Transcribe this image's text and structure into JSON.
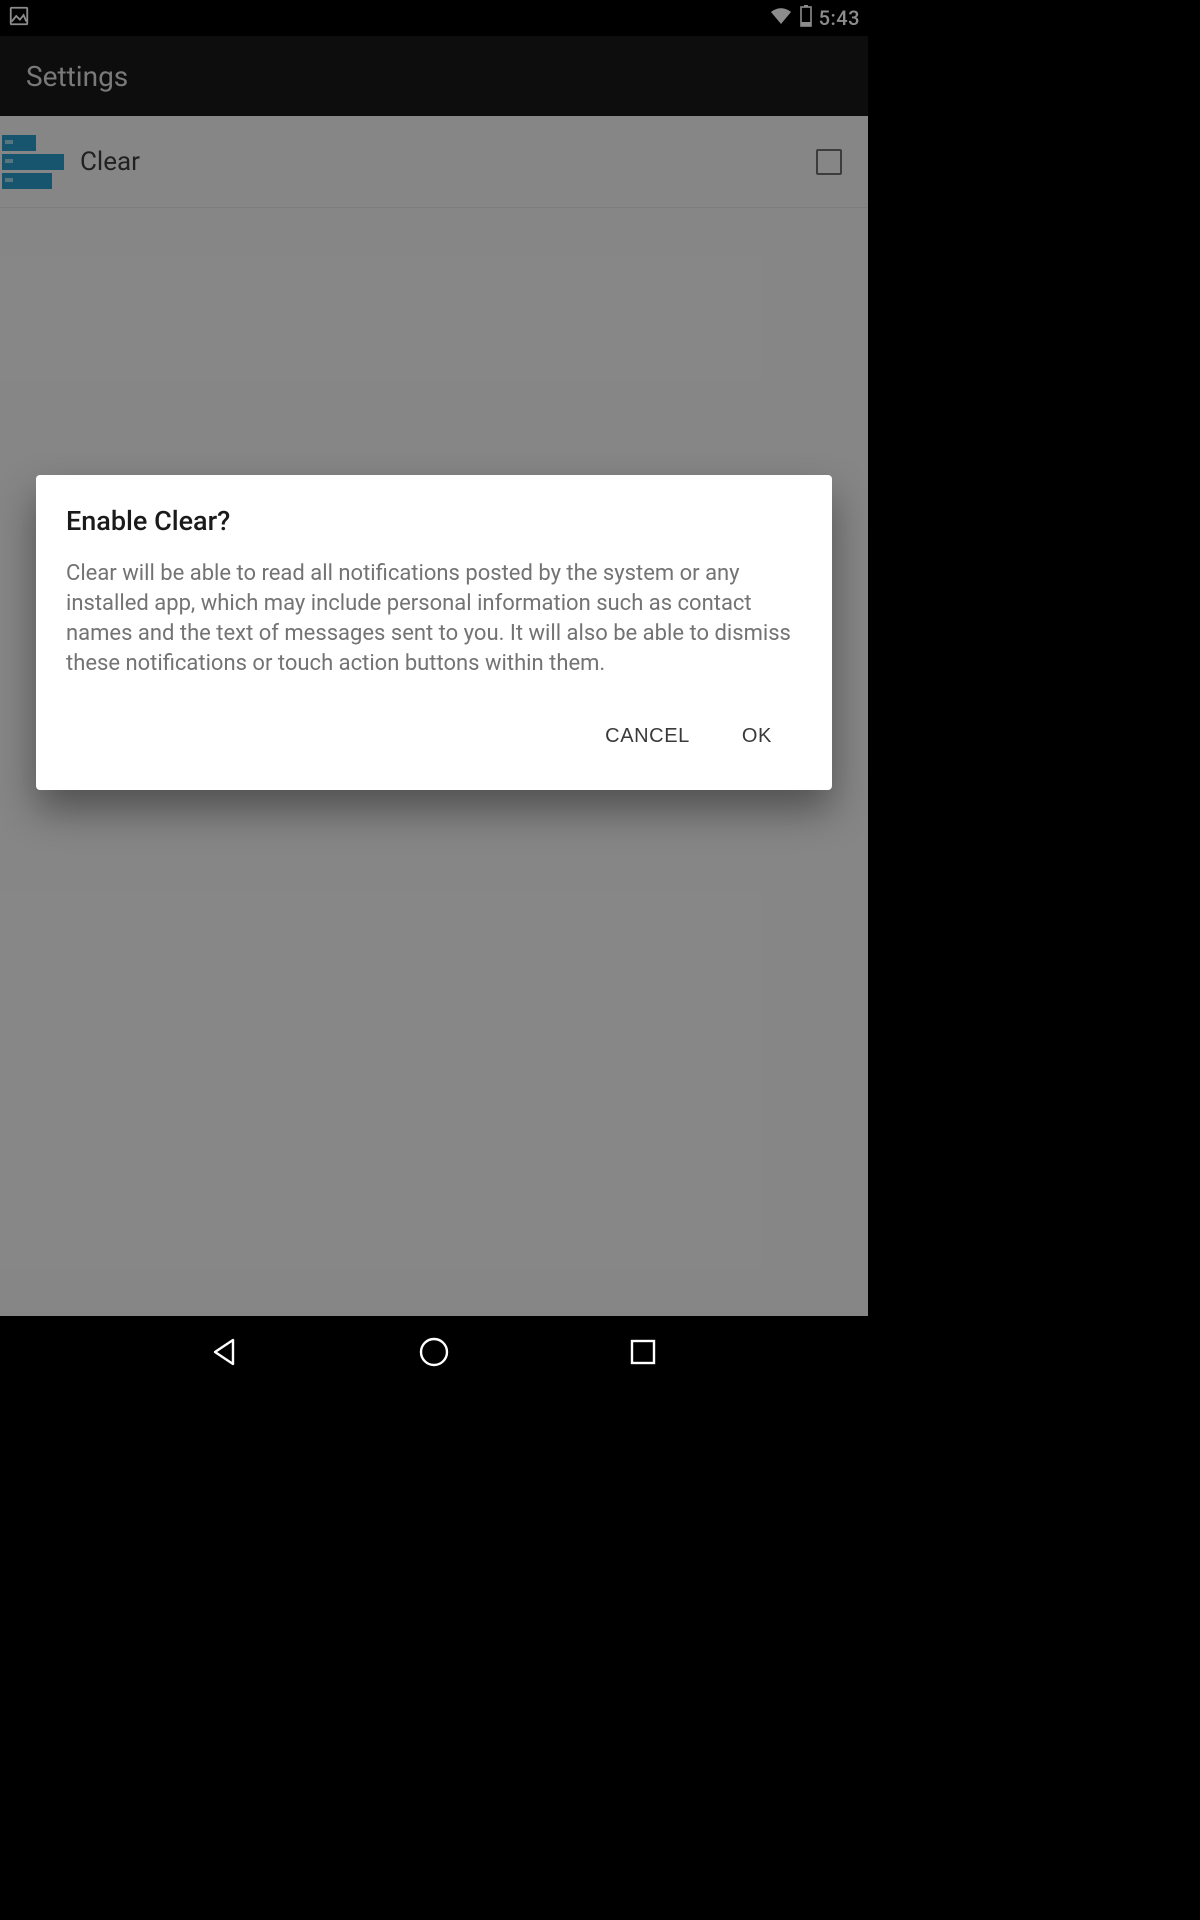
{
  "status_bar": {
    "time": "5:43"
  },
  "app_bar": {
    "title": "Settings"
  },
  "list": {
    "items": [
      {
        "label": "Clear",
        "checked": false
      }
    ]
  },
  "dialog": {
    "title": "Enable Clear?",
    "body": "Clear will be able to read all notifications posted by the system or any installed app, which may include personal information such as contact names and the text of messages sent to you. It will also be able to dismiss these notifications or touch action buttons within them.",
    "cancel": "CANCEL",
    "ok": "OK"
  }
}
